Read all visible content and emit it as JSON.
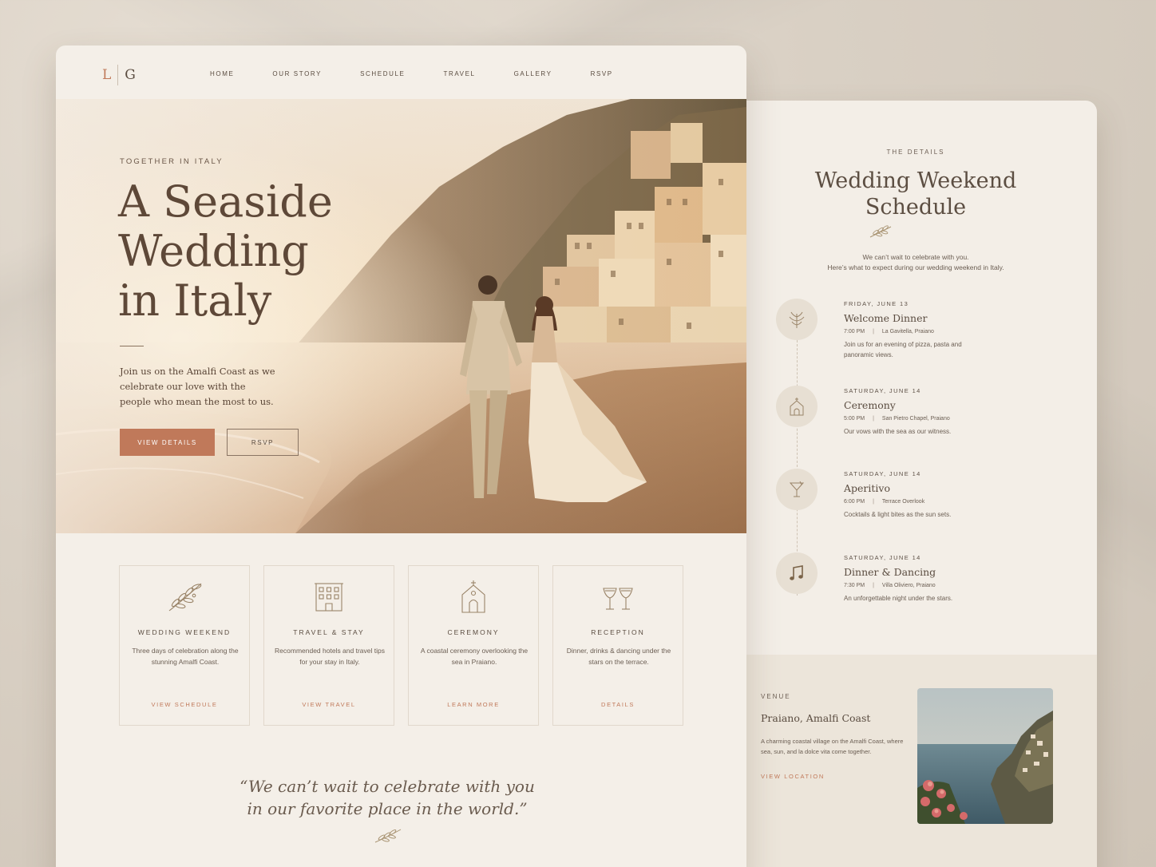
{
  "home": {
    "logo": {
      "left": "L",
      "right": "G"
    },
    "nav": [
      "HOME",
      "OUR STORY",
      "SCHEDULE",
      "TRAVEL",
      "GALLERY",
      "RSVP"
    ],
    "hero": {
      "eyebrow": "TOGETHER IN ITALY",
      "title_lines": [
        "A Seaside",
        "Wedding",
        "in Italy"
      ],
      "subtitle": "Join us on the Amalfi Coast as we celebrate our love with the people who mean the most to us.",
      "primary_button": "VIEW DETAILS",
      "secondary_button": "RSVP"
    },
    "features": [
      {
        "icon": "olive-branch-icon",
        "title": "WEDDING WEEKEND",
        "description": "Three days of celebration along the stunning Amalfi Coast.",
        "link": "VIEW SCHEDULE"
      },
      {
        "icon": "hotel-icon",
        "title": "TRAVEL & STAY",
        "description": "Recommended hotels and travel tips for your stay in Italy.",
        "link": "VIEW TRAVEL"
      },
      {
        "icon": "chapel-icon",
        "title": "CEREMONY",
        "description": "A coastal ceremony overlooking the sea in Praiano.",
        "link": "LEARN MORE"
      },
      {
        "icon": "champagne-glasses-icon",
        "title": "RECEPTION",
        "description": "Dinner, drinks & dancing under the stars on the terrace.",
        "link": "DETAILS"
      }
    ],
    "quote_lines": [
      "“We can’t wait to celebrate with you",
      "in our favorite place in the world.”"
    ]
  },
  "schedule": {
    "eyebrow": "THE DETAILS",
    "title_lines": [
      "Wedding Weekend",
      "Schedule"
    ],
    "intro_lines": [
      "We can’t wait to celebrate with you.",
      "Here’s what to expect during our wedding weekend in Italy."
    ],
    "events": [
      {
        "icon": "olive-sprig-icon",
        "day": "FRIDAY, JUNE 13",
        "name": "Welcome Dinner",
        "time": "7:00 PM",
        "place": "La Gavitella, Praiano",
        "description": "Join us for an evening of pizza, pasta and panoramic views."
      },
      {
        "icon": "chapel-icon",
        "day": "SATURDAY, JUNE 14",
        "name": "Ceremony",
        "time": "5:00 PM",
        "place": "San Pietro Chapel, Praiano",
        "description": "Our vows with the sea as our witness."
      },
      {
        "icon": "cocktail-icon",
        "day": "SATURDAY, JUNE 14",
        "name": "Aperitivo",
        "time": "6:00 PM",
        "place": "Terrace Overlook",
        "description": "Cocktails & light bites as the sun sets."
      },
      {
        "icon": "music-note-icon",
        "day": "SATURDAY, JUNE 14",
        "name": "Dinner & Dancing",
        "time": "7:30 PM",
        "place": "Villa Oliviero, Praiano",
        "description": "An unforgettable night under the stars."
      }
    ],
    "venue": {
      "eyebrow": "VENUE",
      "name": "Praiano, Amalfi Coast",
      "description": "A charming coastal village on the Amalfi Coast, where sea, sun, and la dolce vita come together.",
      "link": "VIEW LOCATION"
    }
  },
  "colors": {
    "accent": "#c0795a",
    "text": "#5a4c40",
    "paper": "#f4efe8"
  }
}
